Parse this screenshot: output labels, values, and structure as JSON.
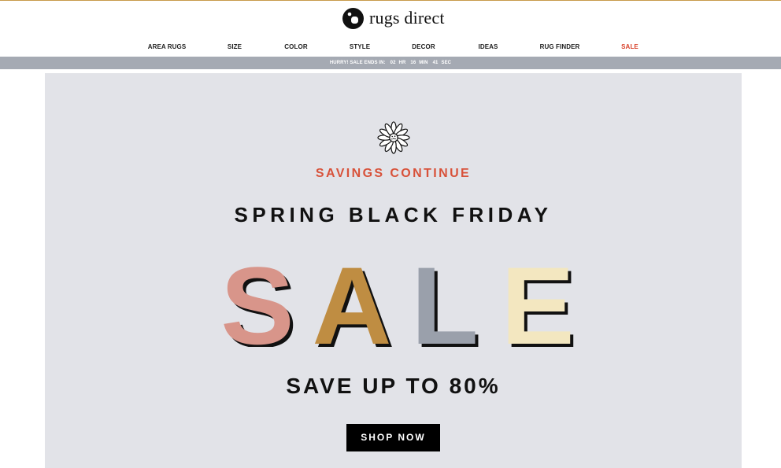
{
  "brand": {
    "name": "rugs direct",
    "logo_icon": "rugs-direct-logo"
  },
  "nav": {
    "items": [
      {
        "label": "AREA RUGS"
      },
      {
        "label": "SIZE"
      },
      {
        "label": "COLOR"
      },
      {
        "label": "STYLE"
      },
      {
        "label": "DECOR"
      },
      {
        "label": "IDEAS"
      },
      {
        "label": "RUG FINDER"
      },
      {
        "label": "SALE"
      }
    ],
    "sale_color": "#d8422b"
  },
  "countdown": {
    "prefix": "HURRY! SALE ENDS IN:",
    "hours": "02",
    "hours_unit": "HR",
    "minutes": "16",
    "minutes_unit": "MIN",
    "seconds": "41",
    "seconds_unit": "SEC"
  },
  "hero": {
    "icon": "flower-icon",
    "eyebrow": "SAVINGS CONTINUE",
    "headline": "SPRING BLACK FRIDAY",
    "sale_word": "SALE",
    "sale_letter_colors": [
      "#d8958a",
      "#bf8d42",
      "#9aa0ab",
      "#f3e7c0"
    ],
    "subhead": "SAVE UP TO 80%",
    "cta_label": "SHOP NOW",
    "background": "#e2e3e8"
  }
}
